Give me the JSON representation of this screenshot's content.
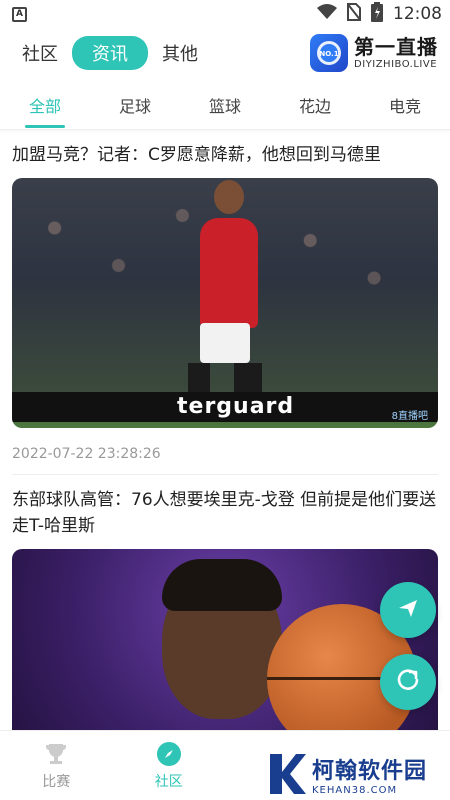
{
  "status_bar": {
    "app_icon_letter": "A",
    "time": "12:08",
    "icons": [
      "wifi-icon",
      "no-sim-icon",
      "battery-icon"
    ]
  },
  "header": {
    "tabs": [
      {
        "label": "社区",
        "active": false
      },
      {
        "label": "资讯",
        "active": true
      },
      {
        "label": "其他",
        "active": false
      }
    ],
    "brand": {
      "logo_text": "NO.1",
      "name": "第一直播",
      "url": "DIYIZHIBO.LIVE"
    }
  },
  "categories": [
    {
      "label": "全部",
      "active": true
    },
    {
      "label": "足球",
      "active": false
    },
    {
      "label": "篮球",
      "active": false
    },
    {
      "label": "花边",
      "active": false
    },
    {
      "label": "电竞",
      "active": false
    }
  ],
  "articles": [
    {
      "title": "加盟马竞？记者：C罗愿意降薪，他想回到马德里",
      "image_board_text": "terguard",
      "image_watermark": "8直播吧",
      "timestamp": "2022-07-22 23:28:26"
    },
    {
      "title": "东部球队高管：76人想要埃里克-戈登 但前提是他们要送走T-哈里斯"
    }
  ],
  "bottom_nav": [
    {
      "label": "比赛",
      "icon": "trophy-icon",
      "active": false
    },
    {
      "label": "社区",
      "icon": "compass-icon",
      "active": true
    },
    {
      "label": "",
      "icon": "nav-icon-3",
      "active": false
    },
    {
      "label": "",
      "icon": "nav-icon-4",
      "active": false
    }
  ],
  "overlay_watermark": {
    "name": "柯翰软件园",
    "url": "KEHAN38.COM"
  },
  "colors": {
    "accent": "#2ec4b6",
    "brand_blue": "#2f7cf6",
    "watermark_blue": "#1a3e8f"
  }
}
